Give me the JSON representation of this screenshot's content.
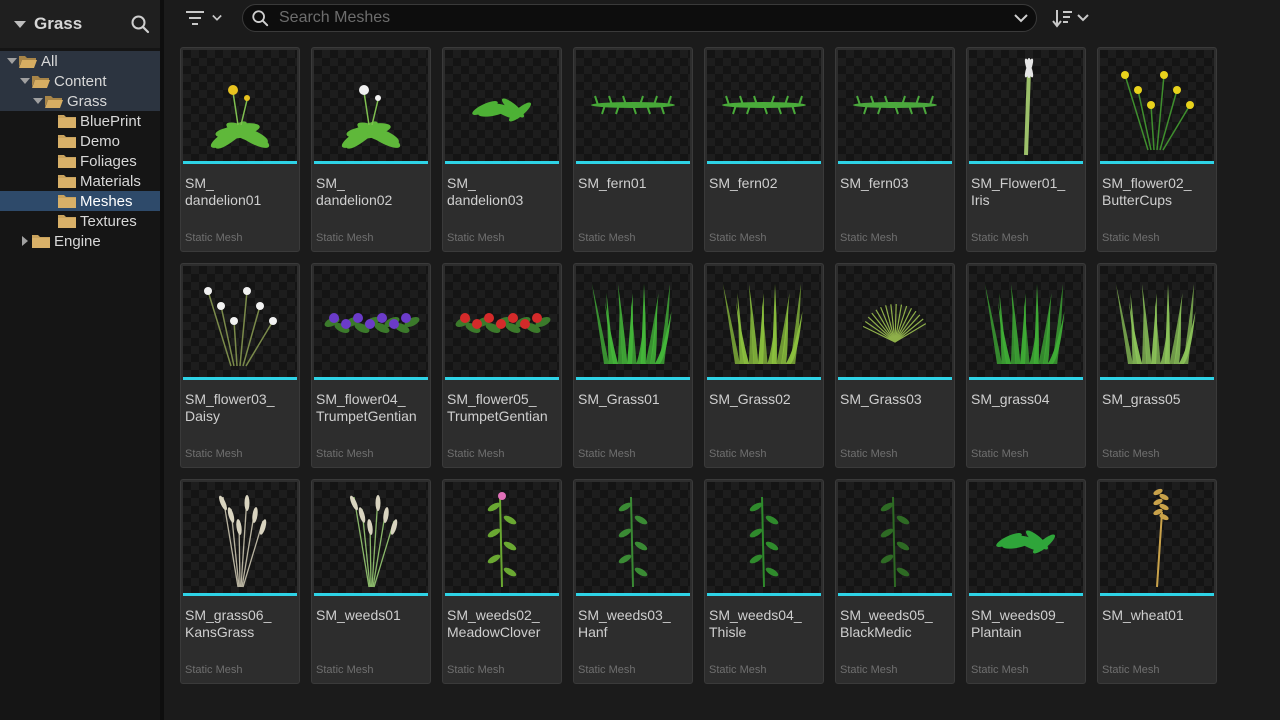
{
  "sidebar": {
    "title": "Grass",
    "tree": [
      {
        "label": "All",
        "depth": 0,
        "arrow": "down",
        "state": "highlight",
        "name": "tree-item-all"
      },
      {
        "label": "Content",
        "depth": 1,
        "arrow": "down",
        "state": "highlight",
        "name": "tree-item-content"
      },
      {
        "label": "Grass",
        "depth": 2,
        "arrow": "down",
        "state": "highlight",
        "name": "tree-item-grass"
      },
      {
        "label": "BluePrint",
        "depth": 3,
        "arrow": "",
        "state": "",
        "name": "tree-item-blueprint"
      },
      {
        "label": "Demo",
        "depth": 3,
        "arrow": "",
        "state": "",
        "name": "tree-item-demo"
      },
      {
        "label": "Foliages",
        "depth": 3,
        "arrow": "",
        "state": "",
        "name": "tree-item-foliages"
      },
      {
        "label": "Materials",
        "depth": 3,
        "arrow": "",
        "state": "",
        "name": "tree-item-materials"
      },
      {
        "label": "Meshes",
        "depth": 3,
        "arrow": "",
        "state": "selected",
        "name": "tree-item-meshes"
      },
      {
        "label": "Textures",
        "depth": 3,
        "arrow": "",
        "state": "",
        "name": "tree-item-textures"
      },
      {
        "label": "Engine",
        "depth": 1,
        "arrow": "right",
        "state": "",
        "name": "tree-item-engine"
      }
    ]
  },
  "toolbar": {
    "search_placeholder": "Search Meshes",
    "search_value": ""
  },
  "colors": {
    "accent": "#2ed3e6",
    "selected_folder": "#2e4a6a",
    "folder": "#c9a25c"
  },
  "assets": [
    {
      "name": "SM_\ndandelion01",
      "type": "Static Mesh",
      "icon": "dandelion-icon",
      "plant": "dandelion",
      "color": "#5fb83a",
      "flower": "#e8c31f"
    },
    {
      "name": "SM_\ndandelion02",
      "type": "Static Mesh",
      "icon": "dandelion-icon",
      "plant": "dandelion",
      "color": "#5fb83a",
      "flower": "#f0f0f0"
    },
    {
      "name": "SM_\ndandelion03",
      "type": "Static Mesh",
      "icon": "dandelion-leaves-icon",
      "plant": "lowleaf",
      "color": "#4db135",
      "flower": ""
    },
    {
      "name": "SM_fern01",
      "type": "Static Mesh",
      "icon": "fern-icon",
      "plant": "fern",
      "color": "#47a838",
      "flower": ""
    },
    {
      "name": "SM_fern02",
      "type": "Static Mesh",
      "icon": "fern-icon",
      "plant": "fern",
      "color": "#4aab3a",
      "flower": ""
    },
    {
      "name": "SM_fern03",
      "type": "Static Mesh",
      "icon": "fern-icon",
      "plant": "fern",
      "color": "#4ba83d",
      "flower": ""
    },
    {
      "name": "SM_Flower01_\nIris",
      "type": "Static Mesh",
      "icon": "iris-icon",
      "plant": "iris",
      "color": "#9cc06a",
      "flower": "#e6e6e6"
    },
    {
      "name": "SM_flower02_\nButterCups",
      "type": "Static Mesh",
      "icon": "buttercup-icon",
      "plant": "flowers",
      "color": "#3f8f2e",
      "flower": "#e8d21c"
    },
    {
      "name": "SM_flower03_\nDaisy",
      "type": "Static Mesh",
      "icon": "daisy-icon",
      "plant": "flowers",
      "color": "#7a8a4a",
      "flower": "#f2f2f2"
    },
    {
      "name": "SM_flower04_\nTrumpetGentian",
      "type": "Static Mesh",
      "icon": "gentian-icon",
      "plant": "bush",
      "color": "#3b7a2b",
      "flower": "#6b3bc9"
    },
    {
      "name": "SM_flower05_\nTrumpetGentian",
      "type": "Static Mesh",
      "icon": "gentian-icon",
      "plant": "bush",
      "color": "#3b7a2b",
      "flower": "#d42a2a"
    },
    {
      "name": "SM_Grass01",
      "type": "Static Mesh",
      "icon": "grass-icon",
      "plant": "grass",
      "color": "#44b83a",
      "flower": ""
    },
    {
      "name": "SM_Grass02",
      "type": "Static Mesh",
      "icon": "grass-icon",
      "plant": "grass",
      "color": "#8cc23e",
      "flower": ""
    },
    {
      "name": "SM_Grass03",
      "type": "Static Mesh",
      "icon": "grass-icon",
      "plant": "thingrass",
      "color": "#8fb04a",
      "flower": ""
    },
    {
      "name": "SM_grass04",
      "type": "Static Mesh",
      "icon": "grass-icon",
      "plant": "grass",
      "color": "#3fae36",
      "flower": ""
    },
    {
      "name": "SM_grass05",
      "type": "Static Mesh",
      "icon": "grass-icon",
      "plant": "grass",
      "color": "#8cc45a",
      "flower": ""
    },
    {
      "name": "SM_grass06_\nKansGrass",
      "type": "Static Mesh",
      "icon": "kans-grass-icon",
      "plant": "plume",
      "color": "#b8b3a0",
      "flower": ""
    },
    {
      "name": "SM_weeds01",
      "type": "Static Mesh",
      "icon": "weeds-icon",
      "plant": "plume",
      "color": "#8ab86a",
      "flower": ""
    },
    {
      "name": "SM_weeds02_\nMeadowClover",
      "type": "Static Mesh",
      "icon": "clover-icon",
      "plant": "stem",
      "color": "#6aa832",
      "flower": "#e06fb8"
    },
    {
      "name": "SM_weeds03_\nHanf",
      "type": "Static Mesh",
      "icon": "hanf-icon",
      "plant": "stem",
      "color": "#3a8a34",
      "flower": ""
    },
    {
      "name": "SM_weeds04_\nThisle",
      "type": "Static Mesh",
      "icon": "thistle-icon",
      "plant": "stem",
      "color": "#2f8a2c",
      "flower": ""
    },
    {
      "name": "SM_weeds05_\nBlackMedic",
      "type": "Static Mesh",
      "icon": "black-medic-icon",
      "plant": "stem",
      "color": "#2e6a24",
      "flower": ""
    },
    {
      "name": "SM_weeds09_\nPlantain",
      "type": "Static Mesh",
      "icon": "plantain-icon",
      "plant": "lowleaf",
      "color": "#2fa53a",
      "flower": ""
    },
    {
      "name": "SM_wheat01",
      "type": "Static Mesh",
      "icon": "wheat-icon",
      "plant": "wheat",
      "color": "#c9a24a",
      "flower": ""
    }
  ]
}
